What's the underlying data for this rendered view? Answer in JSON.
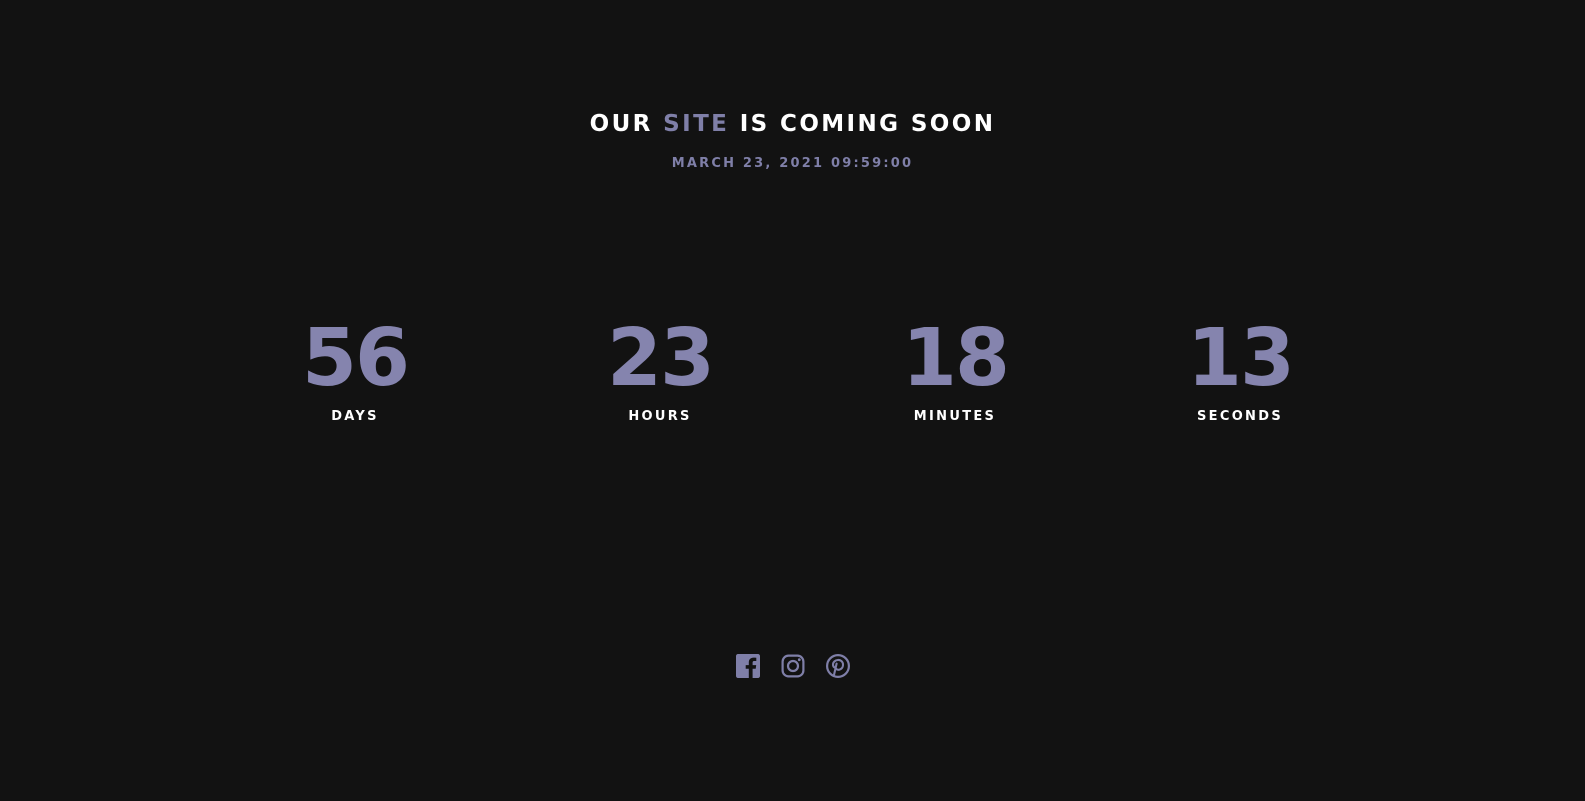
{
  "heading": {
    "prefix": "OUR ",
    "accent": "SITE",
    "suffix": " IS COMING SOON"
  },
  "launch_date": "MARCH 23, 2021 09:59:00",
  "countdown": [
    {
      "value": "56",
      "label": "DAYS"
    },
    {
      "value": "23",
      "label": "HOURS"
    },
    {
      "value": "18",
      "label": "MINUTES"
    },
    {
      "value": "13",
      "label": "SECONDS"
    }
  ],
  "social": [
    {
      "icon": "facebook-icon"
    },
    {
      "icon": "instagram-icon"
    },
    {
      "icon": "pinterest-icon"
    }
  ],
  "colors": {
    "background": "#121212",
    "accent": "#7f7fa8",
    "text": "#ffffff"
  }
}
